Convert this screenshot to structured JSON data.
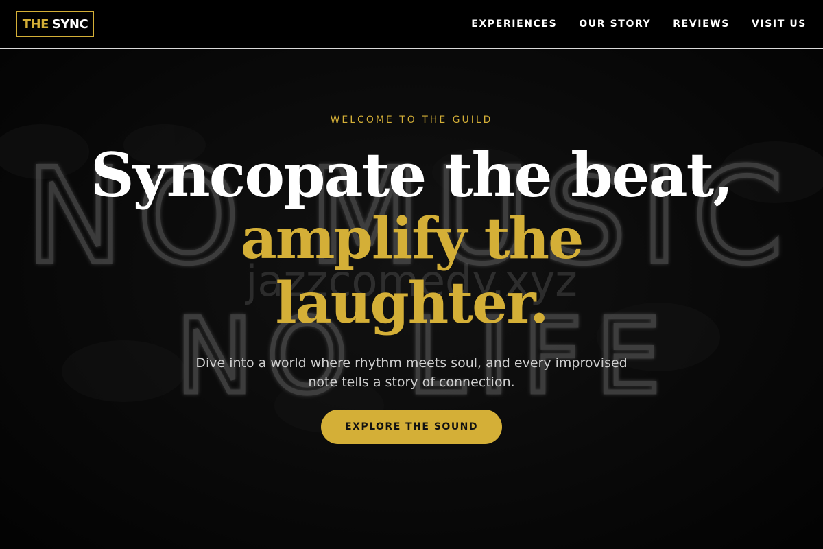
{
  "header": {
    "logo": {
      "the": "THE",
      "sync": "SYNC"
    },
    "nav": [
      "EXPERIENCES",
      "OUR STORY",
      "REVIEWS",
      "VISIT US"
    ]
  },
  "hero": {
    "eyebrow": "WELCOME TO THE GUILD",
    "headline_line1": "Syncopate the beat,",
    "headline_line2": "amplify the",
    "headline_line3": "laughter.",
    "subtext_line1": "Dive into a world where rhythm meets soul, and every improvised",
    "subtext_line2": "note tells a story of connection.",
    "cta_label": "EXPLORE THE SOUND",
    "background_text": {
      "line1": "NO MUSIC",
      "line2": "NO LIFE",
      "watermark": "jazzcomedy.xyz"
    }
  },
  "colors": {
    "accent": "#d4af37",
    "background": "#000000",
    "text": "#ffffff"
  }
}
